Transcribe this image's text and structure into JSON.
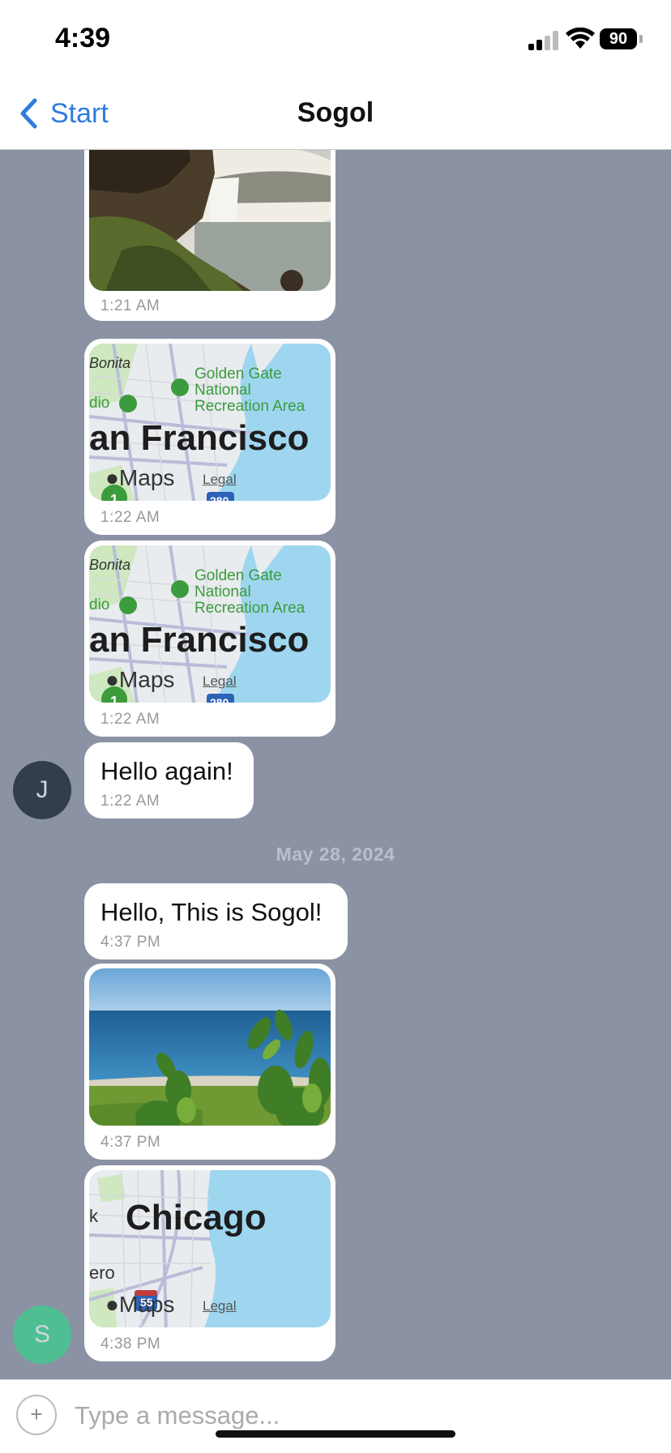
{
  "status_bar": {
    "time": "4:39",
    "battery": "90"
  },
  "nav": {
    "back_label": "Start",
    "title": "Sogol"
  },
  "messages": [
    {
      "type": "image",
      "description": "waterfall",
      "time": "1:21 AM"
    },
    {
      "type": "map",
      "city": "an Francisco",
      "time": "1:22 AM",
      "labels": {
        "neighborhood": "Bonita",
        "park": "Golden Gate National Recreation Area",
        "left_edge": "dio",
        "maps": "Maps",
        "legal": "Legal",
        "highway": "280",
        "route": "1"
      }
    },
    {
      "type": "map",
      "city": "an Francisco",
      "time": "1:22 AM",
      "labels": {
        "neighborhood": "Bonita",
        "park": "Golden Gate National Recreation Area",
        "left_edge": "dio",
        "maps": "Maps",
        "legal": "Legal",
        "highway": "280",
        "route": "1"
      }
    },
    {
      "type": "text",
      "text": "Hello again!",
      "time": "1:22 AM",
      "avatar": "J"
    },
    {
      "type": "date",
      "text": "May 28, 2024"
    },
    {
      "type": "text",
      "text": "Hello, This is Sogol!",
      "time": "4:37 PM"
    },
    {
      "type": "image",
      "description": "lake with plants",
      "time": "4:37 PM"
    },
    {
      "type": "map",
      "city": "Chicago",
      "time": "4:38 PM",
      "labels": {
        "left_top": "k",
        "left_mid": "ero",
        "maps": "Maps",
        "legal": "Legal",
        "highway": "55"
      }
    }
  ],
  "avatars": {
    "j": "J",
    "s": "S"
  },
  "composer": {
    "placeholder": "Type a message...",
    "attach_symbol": "+"
  },
  "colors": {
    "background": "#8b92a3",
    "accent": "#2f7bde",
    "avatar_j": "#323e4e",
    "avatar_s": "#4fbf93"
  }
}
